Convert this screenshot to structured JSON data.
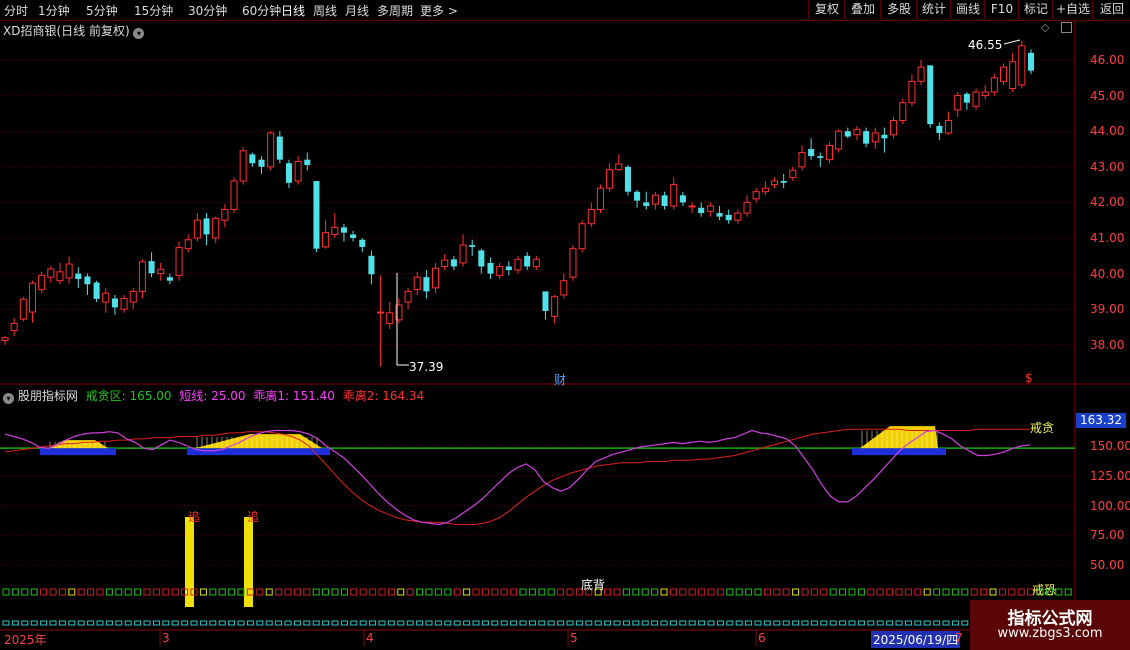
{
  "toolbar": {
    "periods": [
      "分时",
      "1分钟",
      "5分钟",
      "15分钟",
      "30分钟",
      "60分钟",
      "日线",
      "周线",
      "月线",
      "多周期",
      "更多"
    ],
    "more_arrow": ">",
    "right_buttons": [
      "复权",
      "叠加",
      "多股",
      "统计",
      "画线",
      "F10",
      "标记",
      "+自选",
      "返回"
    ]
  },
  "main_chart": {
    "title": "XD招商银(日线 前复权)",
    "high_label": "46.55",
    "low_label": "37.39",
    "event_label": "财",
    "event_label2": "$",
    "y_ticks": [
      "46.00",
      "45.00",
      "44.00",
      "43.00",
      "42.00",
      "41.00",
      "40.00",
      "39.00",
      "38.00"
    ],
    "colors": {
      "up": "#ff3030",
      "down": "#4fe0e8"
    }
  },
  "indicator": {
    "title": "股朋指标网",
    "params": [
      {
        "label": "戒贪区: 165.00",
        "color": "#20c020"
      },
      {
        "label": "短线: 25.00",
        "color": "#ff40ff"
      },
      {
        "label": "乖离1: 151.40",
        "color": "#ff40ff"
      },
      {
        "label": "乖离2: 164.34",
        "color": "#ff3030"
      }
    ],
    "current_value": "163.32",
    "label_greed": "戒贪",
    "label_fear": "戒恐",
    "label_bottom": "底背",
    "label_chase": "追",
    "y_ticks": [
      "150.00",
      "125.00",
      "100.00",
      "75.00",
      "50.00"
    ]
  },
  "dates": [
    "2025年",
    "3",
    "4",
    "5",
    "6",
    "2025/06/19/四",
    "7"
  ],
  "watermark": {
    "line1": "指标公式网",
    "line2": "www.zbgs3.com"
  },
  "chart_data": {
    "type": "candlestick",
    "title": "XD招商银(日线 前复权)",
    "high": 46.55,
    "low": 37.39,
    "ylim": [
      37.2,
      46.8
    ],
    "ohlc": [
      [
        38.12,
        38.2,
        38.0,
        38.25
      ],
      [
        38.4,
        38.6,
        38.25,
        38.75
      ],
      [
        38.72,
        39.28,
        38.65,
        39.35
      ],
      [
        38.92,
        39.73,
        38.62,
        39.8
      ],
      [
        39.55,
        39.95,
        39.45,
        40.05
      ],
      [
        39.9,
        40.13,
        39.75,
        40.22
      ],
      [
        39.8,
        40.05,
        39.7,
        40.3
      ],
      [
        39.88,
        40.27,
        39.72,
        40.48
      ],
      [
        40.0,
        39.85,
        39.6,
        40.18
      ],
      [
        39.92,
        39.7,
        39.4,
        40.0
      ],
      [
        39.75,
        39.29,
        39.2,
        39.8
      ],
      [
        39.2,
        39.45,
        38.9,
        39.6
      ],
      [
        39.3,
        39.05,
        38.85,
        39.4
      ],
      [
        39.0,
        39.3,
        38.9,
        39.4
      ],
      [
        39.2,
        39.5,
        39.0,
        39.6
      ],
      [
        39.5,
        40.33,
        39.3,
        40.4
      ],
      [
        40.35,
        40.01,
        39.9,
        40.6
      ],
      [
        40.0,
        40.12,
        39.8,
        40.3
      ],
      [
        39.9,
        39.8,
        39.7,
        40.0
      ],
      [
        39.95,
        40.73,
        39.8,
        40.9
      ],
      [
        40.7,
        40.95,
        40.6,
        41.1
      ],
      [
        41.0,
        41.5,
        40.9,
        41.7
      ],
      [
        41.55,
        41.1,
        40.8,
        41.7
      ],
      [
        41.0,
        41.55,
        40.85,
        41.6
      ],
      [
        41.5,
        41.8,
        41.3,
        41.95
      ],
      [
        41.8,
        42.6,
        41.7,
        42.7
      ],
      [
        42.6,
        43.45,
        42.5,
        43.55
      ],
      [
        43.35,
        43.1,
        43.0,
        43.4
      ],
      [
        43.2,
        43.0,
        42.8,
        43.3
      ],
      [
        43.0,
        43.95,
        42.9,
        44.0
      ],
      [
        43.85,
        43.2,
        43.1,
        44.0
      ],
      [
        43.1,
        42.55,
        42.4,
        43.2
      ],
      [
        42.6,
        43.15,
        42.5,
        43.3
      ],
      [
        43.2,
        43.05,
        42.9,
        43.4
      ],
      [
        42.6,
        40.7,
        40.6,
        42.6
      ],
      [
        40.75,
        41.15,
        40.7,
        41.5
      ],
      [
        41.1,
        41.3,
        41.0,
        41.7
      ],
      [
        41.3,
        41.15,
        40.9,
        41.4
      ],
      [
        41.1,
        41.0,
        40.9,
        41.2
      ],
      [
        40.95,
        40.75,
        40.6,
        41.0
      ],
      [
        40.5,
        39.98,
        39.7,
        40.65
      ],
      [
        38.9,
        38.92,
        37.39,
        39.95
      ],
      [
        38.6,
        38.9,
        38.45,
        39.2
      ],
      [
        38.7,
        39.12,
        38.6,
        39.3
      ],
      [
        39.2,
        39.5,
        39.0,
        39.6
      ],
      [
        39.55,
        39.9,
        39.4,
        40.05
      ],
      [
        39.9,
        39.5,
        39.3,
        40.1
      ],
      [
        39.6,
        40.15,
        39.45,
        40.3
      ],
      [
        40.2,
        40.38,
        40.1,
        40.55
      ],
      [
        40.4,
        40.2,
        40.1,
        40.5
      ],
      [
        40.3,
        40.8,
        40.2,
        41.1
      ],
      [
        40.8,
        40.75,
        40.5,
        40.95
      ],
      [
        40.65,
        40.2,
        40.0,
        40.7
      ],
      [
        40.3,
        40.0,
        39.85,
        40.45
      ],
      [
        39.95,
        40.2,
        39.85,
        40.3
      ],
      [
        40.2,
        40.1,
        39.95,
        40.35
      ],
      [
        40.1,
        40.4,
        40.0,
        40.5
      ],
      [
        40.5,
        40.2,
        40.1,
        40.6
      ],
      [
        40.2,
        40.4,
        40.1,
        40.5
      ],
      [
        39.5,
        38.95,
        38.7,
        39.5
      ],
      [
        38.8,
        39.35,
        38.6,
        39.4
      ],
      [
        39.4,
        39.8,
        39.3,
        40.0
      ],
      [
        39.9,
        40.7,
        39.8,
        40.8
      ],
      [
        40.7,
        41.4,
        40.6,
        41.5
      ],
      [
        41.4,
        41.8,
        41.3,
        42.0
      ],
      [
        41.8,
        42.4,
        41.7,
        42.5
      ],
      [
        42.4,
        42.92,
        42.3,
        43.1
      ],
      [
        42.92,
        43.08,
        42.9,
        43.35
      ],
      [
        43.0,
        42.3,
        42.2,
        43.05
      ],
      [
        42.3,
        42.05,
        41.85,
        42.35
      ],
      [
        42.0,
        41.9,
        41.8,
        42.3
      ],
      [
        41.95,
        42.2,
        41.8,
        42.3
      ],
      [
        42.2,
        41.9,
        41.8,
        42.3
      ],
      [
        41.9,
        42.5,
        41.8,
        42.7
      ],
      [
        42.2,
        42.0,
        41.9,
        42.3
      ],
      [
        41.9,
        41.9,
        41.7,
        42.0
      ],
      [
        41.85,
        41.7,
        41.6,
        42.0
      ],
      [
        41.75,
        41.9,
        41.6,
        42.0
      ],
      [
        41.7,
        41.6,
        41.5,
        41.9
      ],
      [
        41.65,
        41.5,
        41.4,
        41.8
      ],
      [
        41.5,
        41.7,
        41.4,
        41.8
      ],
      [
        41.7,
        42.0,
        41.6,
        42.2
      ],
      [
        42.1,
        42.3,
        42.0,
        42.4
      ],
      [
        42.3,
        42.4,
        42.2,
        42.6
      ],
      [
        42.5,
        42.6,
        42.4,
        42.7
      ],
      [
        42.6,
        42.55,
        42.4,
        42.8
      ],
      [
        42.7,
        42.9,
        42.6,
        43.0
      ],
      [
        43.0,
        43.4,
        42.9,
        43.6
      ],
      [
        43.5,
        43.3,
        43.2,
        43.8
      ],
      [
        43.3,
        43.25,
        43.0,
        43.4
      ],
      [
        43.2,
        43.6,
        43.1,
        43.7
      ],
      [
        43.5,
        44.0,
        43.4,
        44.05
      ],
      [
        44.0,
        43.85,
        43.8,
        44.1
      ],
      [
        43.9,
        44.05,
        43.75,
        44.15
      ],
      [
        44.0,
        43.65,
        43.55,
        44.1
      ],
      [
        43.7,
        43.95,
        43.5,
        44.1
      ],
      [
        43.9,
        43.8,
        43.4,
        44.1
      ],
      [
        43.9,
        44.3,
        43.8,
        44.4
      ],
      [
        44.3,
        44.8,
        44.2,
        44.9
      ],
      [
        44.8,
        45.4,
        44.7,
        45.6
      ],
      [
        45.4,
        45.8,
        45.3,
        46.0
      ],
      [
        45.85,
        44.2,
        44.1,
        45.85
      ],
      [
        44.15,
        43.95,
        43.75,
        44.25
      ],
      [
        43.95,
        44.3,
        43.9,
        44.55
      ],
      [
        44.6,
        45.0,
        44.4,
        45.1
      ],
      [
        45.05,
        44.8,
        44.6,
        45.1
      ],
      [
        44.7,
        45.1,
        44.6,
        45.2
      ],
      [
        45.0,
        45.1,
        44.9,
        45.3
      ],
      [
        45.1,
        45.5,
        45.0,
        45.6
      ],
      [
        45.4,
        45.8,
        45.3,
        45.9
      ],
      [
        45.2,
        45.95,
        45.1,
        46.2
      ],
      [
        45.3,
        46.4,
        45.2,
        46.55
      ],
      [
        46.2,
        45.7,
        45.6,
        46.3
      ]
    ],
    "indicator": {
      "greed_zone": 165,
      "y_ticks": [
        150,
        125,
        100,
        75,
        50
      ],
      "line_bias1": [
        160,
        158,
        156,
        153,
        149,
        148,
        151,
        155,
        158,
        160,
        161,
        161,
        162,
        161,
        156,
        153,
        148,
        147,
        151,
        155,
        153,
        150,
        147,
        146,
        146,
        147,
        150,
        153,
        157,
        160,
        162,
        163,
        163,
        163,
        162,
        160,
        156,
        150,
        145,
        140,
        133,
        126,
        118,
        110,
        103,
        97,
        92,
        88,
        86,
        85,
        84,
        86,
        90,
        95,
        100,
        106,
        113,
        120,
        127,
        132,
        135,
        130,
        120,
        115,
        112,
        115,
        122,
        130,
        137,
        140,
        143,
        145,
        147,
        149,
        150,
        151,
        152,
        153,
        152,
        153,
        154,
        153,
        154,
        156,
        157,
        160,
        163,
        161,
        160,
        158,
        156,
        150,
        140,
        130,
        118,
        108,
        103,
        103,
        108,
        115,
        122,
        130,
        138,
        146,
        152,
        157,
        162,
        163,
        160,
        156,
        150,
        146,
        142,
        142,
        143,
        145,
        148,
        150,
        151
      ],
      "line_bias2": [
        145,
        146,
        147,
        148,
        149,
        150,
        151,
        152,
        152,
        153,
        153,
        154,
        154,
        155,
        155,
        156,
        156,
        157,
        157,
        157,
        158,
        158,
        158,
        159,
        159,
        160,
        161,
        161,
        162,
        162,
        162,
        161,
        160,
        158,
        155,
        150,
        142,
        134,
        126,
        118,
        111,
        105,
        100,
        96,
        93,
        90,
        88,
        87,
        86,
        86,
        86,
        85,
        84,
        84,
        84,
        85,
        87,
        90,
        95,
        101,
        107,
        112,
        117,
        121,
        124,
        127,
        129,
        131,
        133,
        134,
        135,
        136,
        136,
        136,
        137,
        137,
        137,
        138,
        138,
        138,
        139,
        139,
        140,
        141,
        142,
        144,
        146,
        148,
        150,
        152,
        154,
        156,
        158,
        160,
        161,
        162,
        163,
        164,
        164,
        164,
        164,
        164,
        164,
        164,
        163,
        163,
        163,
        163,
        163,
        163,
        163,
        163,
        164,
        164,
        164,
        164,
        164,
        164,
        164
      ]
    }
  }
}
